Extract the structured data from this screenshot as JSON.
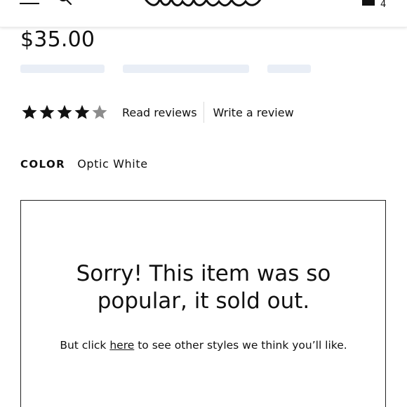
{
  "header": {
    "logo_text": "Madewell",
    "bag_count": "4"
  },
  "product": {
    "price": "$35.00",
    "rating": 4.5,
    "rating_max": 5,
    "read_reviews_label": "Read reviews",
    "write_review_label": "Write a review",
    "color_label": "COLOR",
    "color_value": "Optic White"
  },
  "soldout": {
    "title_line1": "Sorry! This item was so",
    "title_line2": "popular, it sold out.",
    "text_before": "But click ",
    "link_label": "here",
    "text_after": " to see other styles we think you’ll like."
  },
  "colors": {
    "text": "#111111",
    "star_filled": "#111111",
    "star_empty": "#8c8c8c",
    "faded": "#e9eef6"
  }
}
